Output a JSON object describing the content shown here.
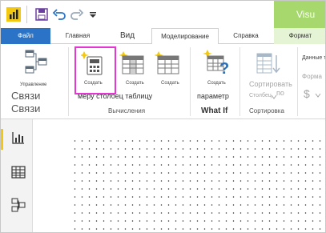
{
  "titlebar": {
    "visual_tab": "Visu"
  },
  "tabs": [
    {
      "label": "Файл"
    },
    {
      "label": "Главная"
    },
    {
      "label": "Вид"
    },
    {
      "label": "Моделирование"
    },
    {
      "label": "Справка"
    },
    {
      "label": "Формат"
    }
  ],
  "ribbon": {
    "relationships": {
      "small_label": "Управление",
      "big1": "Связи",
      "big2": "Связи"
    },
    "calc": {
      "measure_small": "Создать",
      "column_small": "Создать",
      "table_small": "Создать",
      "labels_line": "меру столбец таблицу",
      "group": "Вычисления"
    },
    "whatif": {
      "small": "Создать",
      "label": "параметр",
      "group": "What If"
    },
    "sort": {
      "label_line1": "Сортировать",
      "label_line2": "по",
      "label_line3": "Столбец",
      "group": "Сортировка"
    },
    "formatting": {
      "data_type": "Данные т",
      "format": "Форма",
      "currency": "$"
    }
  },
  "rail": {
    "items": [
      "report-view",
      "data-view",
      "model-view"
    ]
  },
  "colors": {
    "file_tab": "#2b73c6",
    "visual_tab": "#a6d86e",
    "highlight": "#e535d4",
    "rail_active": "#f2c811",
    "pbi_yellow": "#f2c811"
  }
}
